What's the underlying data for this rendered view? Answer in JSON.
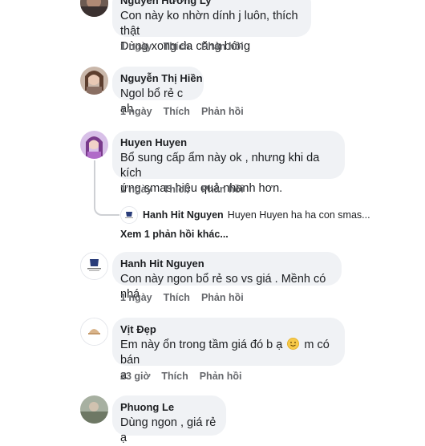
{
  "comments": [
    {
      "author": "Nguyễn Hương Ly",
      "text_lines": [
        "Con này ko nhờn dính j luôn, thích thật",
        "Dùng xong da căng bóng"
      ],
      "time": "1 ngày",
      "like": "Thích",
      "reply": "Phản hồi"
    },
    {
      "author": "Nguyễn Thị Hiền",
      "text_lines": [
        "Ngol bổ rẻ c ah"
      ],
      "time": "1 ngày",
      "like": "Thích",
      "reply": "Phản hồi"
    },
    {
      "author": "Huyen Huyen",
      "text_lines": [
        "Bổ sung cấp ẩm này ok , nhưng khi da kích",
        "ứng smas hiệu quả nhanh hơn."
      ],
      "time": "1 ngày",
      "like": "Thích",
      "reply": "Phản hồi",
      "reply_preview": {
        "author": "Hanh Hit Nguyen",
        "snippet": "Huyen Huyen  ha ha con smas..."
      },
      "more_replies": "Xem 1 phản hồi khác..."
    },
    {
      "author": "Hanh Hit Nguyen",
      "text_lines": [
        "Con này ngon bổ rẻ so vs giá . Mềnh có nhá"
      ],
      "time": "1 ngày",
      "like": "Thích",
      "reply": "Phản hồi"
    },
    {
      "author": "Vịt Đẹp",
      "text_before_emoji": "Em này ổn trong tầm giá đó b ạ",
      "text_after_emoji": "m có bán",
      "text_line2": "a",
      "time": "23 giờ",
      "like": "Thích",
      "reply": "Phản hồi"
    },
    {
      "author": "Phuong Le",
      "text_lines": [
        "Dùng ngon , giá rẻ ạ"
      ]
    }
  ],
  "colors": {
    "bubble": "#f0f2f5",
    "action_text": "#65676b",
    "thread_line": "#ced0d4"
  }
}
